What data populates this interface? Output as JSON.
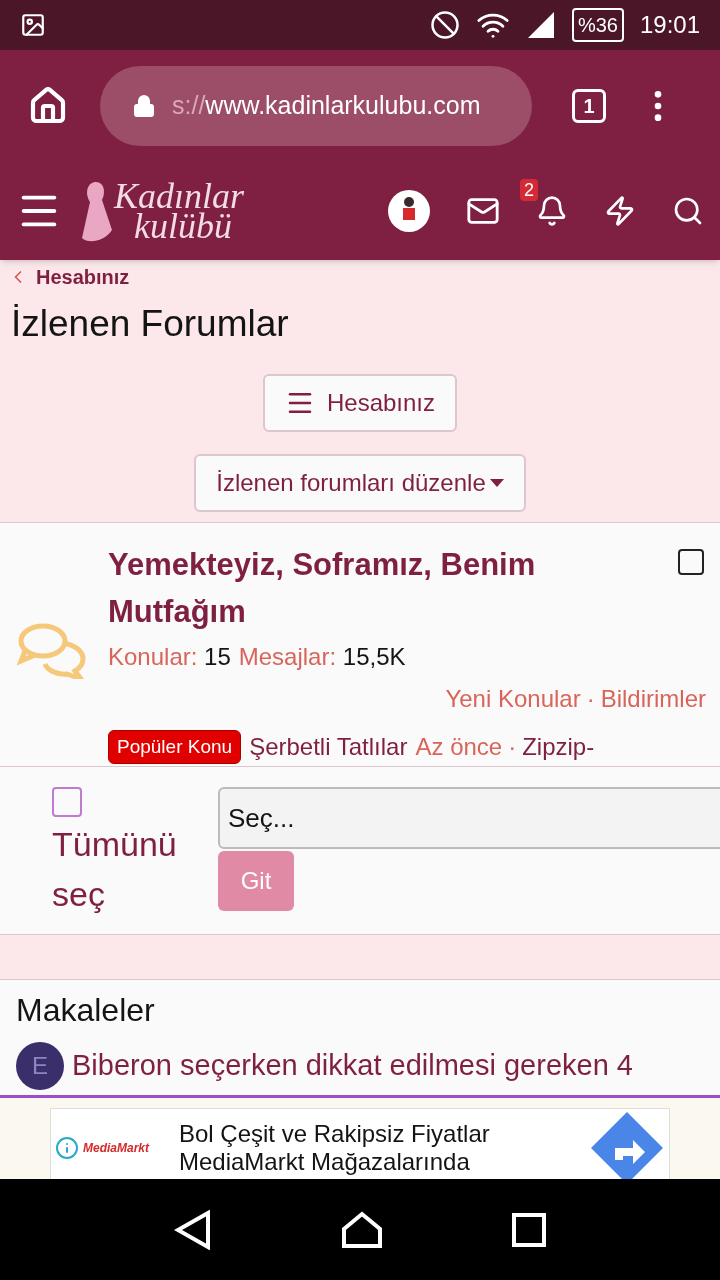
{
  "status_bar": {
    "battery": "%36",
    "time": "19:01"
  },
  "browser": {
    "url_faded": "s://",
    "url": "www.kadinlarkulubu.com",
    "tab_count": "1"
  },
  "site_header": {
    "logo_line1": "Kadınlar",
    "logo_line2": "kulübü",
    "notification_count": "2"
  },
  "breadcrumb": "Hesabınız",
  "page_title": "İzlenen Forumlar",
  "account_button": "Hesabınız",
  "edit_button": "İzlenen forumları düzenle",
  "forum": {
    "title": "Yemekteyiz, Soframız, Benim Mutfağım",
    "checked": false,
    "stats": [
      {
        "label": "Konular:",
        "value": "15"
      },
      {
        "label": "Mesajlar:",
        "value": "15,5K"
      }
    ],
    "links": [
      "Yeni Konular",
      "Bildirimler"
    ],
    "link_separator": "·",
    "latest_separator": "·",
    "latest": {
      "badge": "Popüler Konu",
      "thread": "Şerbetli Tatlılar",
      "time": "Az önce",
      "user": "Zipzip-"
    }
  },
  "bulk": {
    "select_all": "Tümünü seç",
    "checked": false,
    "select_value": "Seç...",
    "go_button": "Git",
    "go_disabled": true
  },
  "articles": {
    "heading": "Makaleler",
    "items": [
      {
        "initial": "E",
        "title": "Biberon seçerken dikkat edilmesi gereken 4"
      }
    ]
  },
  "ad": {
    "brand": "MediaMarkt",
    "lines": [
      "Bol Çeşit ve Rakipsiz Fiyatlar",
      "MediaMarkt Mağazalarında"
    ]
  }
}
